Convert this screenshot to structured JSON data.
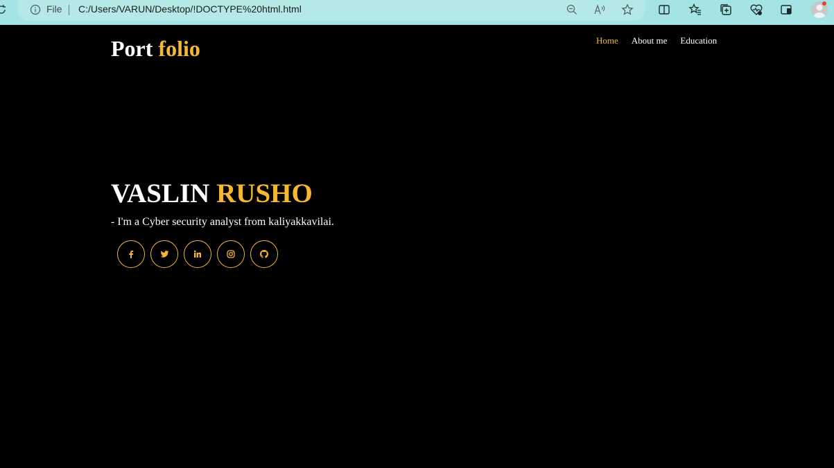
{
  "browser": {
    "file_label": "File",
    "url": "C:/Users/VARUN/Desktop/!DOCTYPE%20html.html"
  },
  "header": {
    "logo_part1": "Port",
    "logo_part2": "folio",
    "nav": [
      {
        "label": "Home",
        "active": true
      },
      {
        "label": "About me",
        "active": false
      },
      {
        "label": "Education",
        "active": false
      }
    ]
  },
  "hero": {
    "first_name": "VASLIN",
    "last_name": "RUSHO",
    "tagline": "- I'm a Cyber security analyst from kaliyakkavilai.",
    "socials": [
      "facebook-icon",
      "twitter-icon",
      "linkedin-icon",
      "instagram-icon",
      "github-icon"
    ]
  },
  "colors": {
    "accent": "#f7b733",
    "background": "#000000",
    "browser_bar": "#a5e4e4"
  }
}
